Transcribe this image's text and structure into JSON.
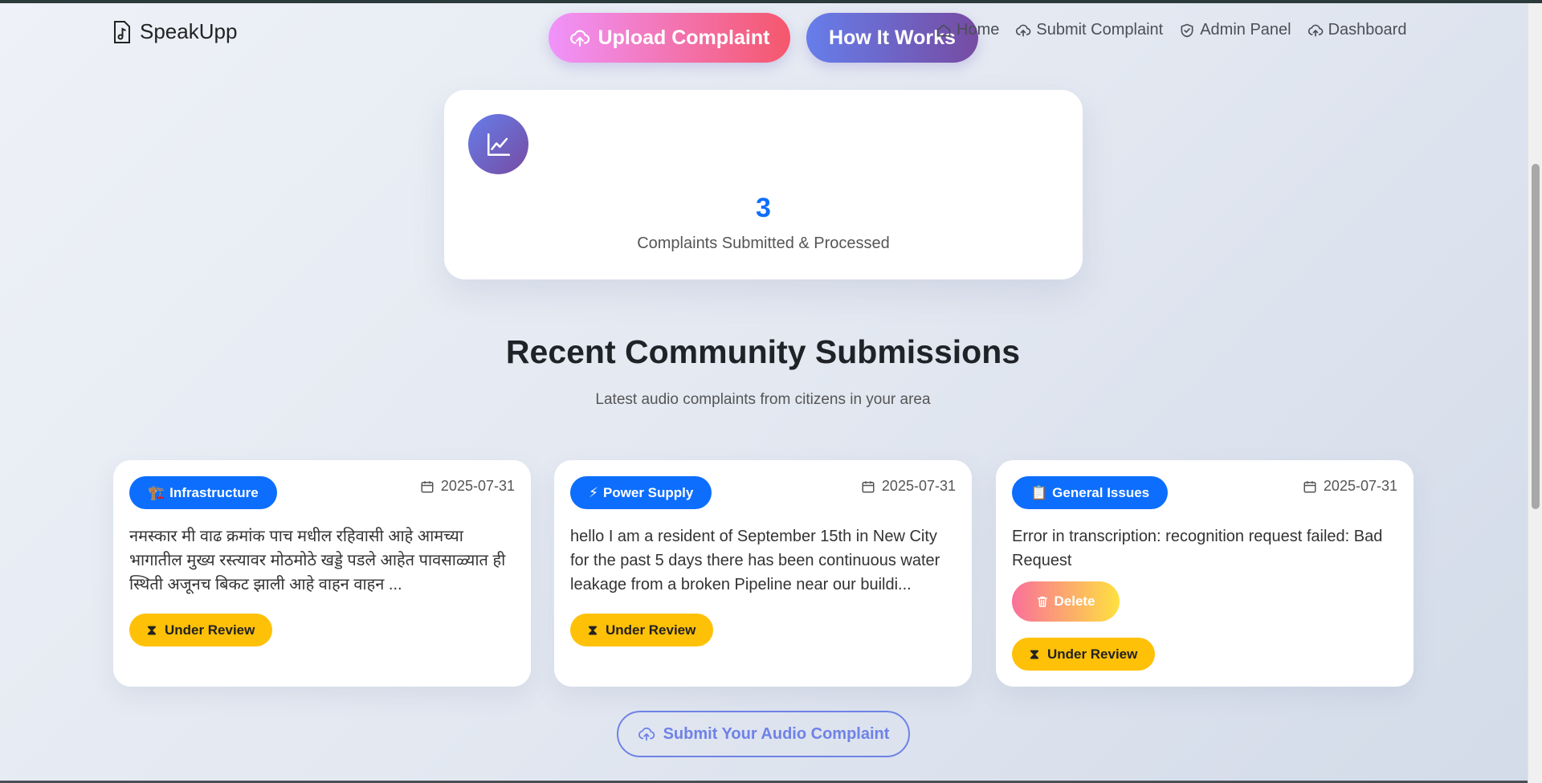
{
  "brand": {
    "name": "SpeakUpp"
  },
  "hero_buttons": {
    "upload": "Upload Complaint",
    "how": "How It Works"
  },
  "nav": [
    "Home",
    "Submit Complaint",
    "Admin Panel",
    "Dashboard"
  ],
  "stats": {
    "value": "3",
    "label": "Complaints Submitted & Processed"
  },
  "section": {
    "title": "Recent Community Submissions",
    "subtitle": "Latest audio complaints from citizens in your area"
  },
  "cards": [
    {
      "category": "Infrastructure",
      "category_icon": "🏗️",
      "date": "2025-07-31",
      "text": "नमस्कार मी वाढ क्रमांक पाच मधील रहिवासी आहे आमच्या भागातील मुख्य रस्त्यावर मोठमोठे खड्डे पडले आहेत पावसाळ्यात ही स्थिती अजूनच बिकट झाली आहे वाहन वाहन ...",
      "status": "Under Review"
    },
    {
      "category": "Power Supply",
      "category_icon": "⚡",
      "date": "2025-07-31",
      "text": "hello I am a resident of September 15th in New City for the past 5 days there has been continuous water leakage from a broken Pipeline near our buildi...",
      "status": "Under Review"
    },
    {
      "category": "General Issues",
      "category_icon": "📋",
      "date": "2025-07-31",
      "text": "Error in transcription: recognition request failed: Bad Request",
      "delete_label": "Delete",
      "status": "Under Review"
    }
  ],
  "submit_button": "Submit Your Audio Complaint",
  "colors": {
    "primary": "#0d6efd",
    "warning": "#ffc107",
    "upload_gradient": [
      "#f093fb",
      "#f5576c"
    ],
    "how_gradient": [
      "#667eea",
      "#764ba2"
    ],
    "delete_gradient": [
      "#fa709a",
      "#fee140"
    ]
  }
}
